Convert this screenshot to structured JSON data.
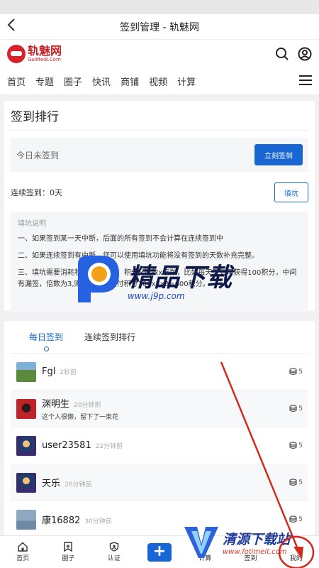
{
  "navbar": {
    "back_icon": "chevron-left-icon",
    "title": "签到管理 - 轨魅网"
  },
  "header": {
    "logo_name": "轨魅网",
    "logo_sub": "GuiMei8.Com",
    "icons": [
      "search-icon",
      "user-icon"
    ]
  },
  "topnav": {
    "items": [
      "首页",
      "专题",
      "圈子",
      "快讯",
      "商铺",
      "视频",
      "计算"
    ],
    "menu_icon": "menu-icon"
  },
  "signin": {
    "title": "签到排行",
    "status": "今日未签到",
    "sign_button": "立刻签到",
    "consecutive_label": "连续签到：",
    "consecutive_value": "0天",
    "fill_button": "填坑",
    "fill_help": {
      "heading": "填坑说明",
      "lines": [
        "一、如果签到某一天中断，后面的所有签到不会计算在连续签到中",
        "二、如果连续签到有中断，您可以使用填坑功能将没有签到的天数补充完整。",
        "三、填坑需要消耗积分，方法是：积分×坑数x倍数，比如每天签到可获得100积分，中间有漏签，倍数为3,则最终需要支付积分100x2x3=600积分。"
      ]
    }
  },
  "tabs": [
    {
      "label": "每日签到",
      "active": true
    },
    {
      "label": "连续签到排行",
      "active": false
    }
  ],
  "list": [
    {
      "name": "Fgl",
      "time": "2秒前",
      "bio": "",
      "points": "5"
    },
    {
      "name": "渊明生",
      "time": "20分钟前",
      "bio": "这个人很懒，留下了一束花",
      "points": "5"
    },
    {
      "name": "user23581",
      "time": "22分钟前",
      "bio": "",
      "points": "5"
    },
    {
      "name": "天乐",
      "time": "26分钟前",
      "bio": "",
      "points": "5"
    },
    {
      "name": "康16882",
      "time": "30分钟前",
      "bio": "",
      "points": "5"
    }
  ],
  "tabbar": [
    {
      "label": "首页",
      "icon": "home-icon"
    },
    {
      "label": "圈子",
      "icon": "bookmark-star-icon"
    },
    {
      "label": "认证",
      "icon": "shield-icon"
    },
    {
      "label": "",
      "icon": "plus-icon"
    },
    {
      "label": "计算",
      "icon": ""
    },
    {
      "label": "签到",
      "icon": ""
    },
    {
      "label": "我的",
      "icon": ""
    }
  ],
  "watermark": {
    "big": "精品下载",
    "small": "www.j9p.com"
  },
  "watermark2": {
    "big": "清源下载站",
    "small": "www.fotimeit.com"
  },
  "colors": {
    "accent": "#1766d4",
    "brand": "#c71d24",
    "annotation": "#d42a1e"
  }
}
